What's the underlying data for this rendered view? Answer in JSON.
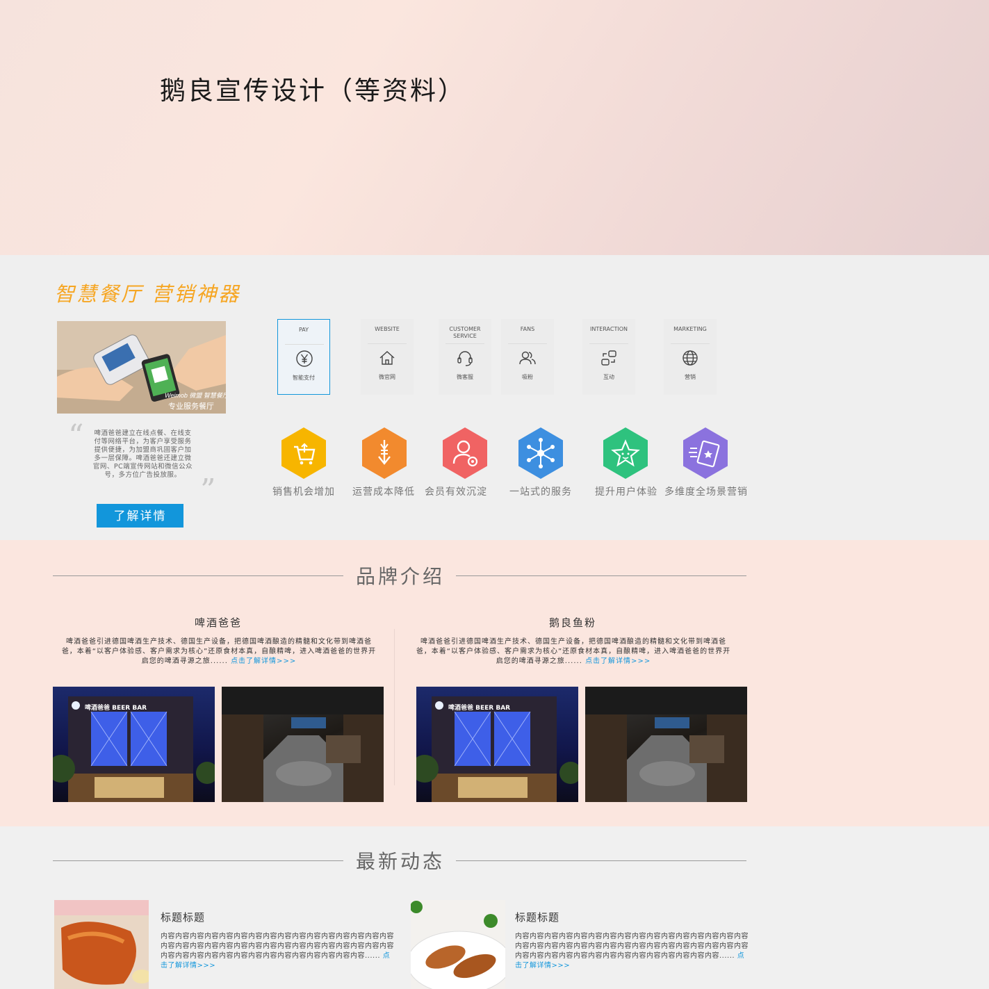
{
  "hero": {
    "title": "鹅良宣传设计（等资料）"
  },
  "smart": {
    "slogan": "智慧餐厅  营销神器",
    "photo_caption_1": "Weimob 微盟 智慧餐厅",
    "photo_caption_2": "专业服务餐厅",
    "intro": "啤酒爸爸建立在线点餐、在线支付等网络平台，为客户享受服务提供便捷，为加盟商巩固客户加多一层保障。啤酒爸爸还建立微官网、PC端宣传网站和微信公众号，多方位广告投放服。",
    "button": "了解详情",
    "services": [
      {
        "en": "PAY",
        "cn": "智能支付",
        "icon": "yuan-icon"
      },
      {
        "en": "WEBSITE",
        "cn": "微官网",
        "icon": "home-icon"
      },
      {
        "en": "CUSTOMER SERVICE",
        "cn": "微客服",
        "icon": "headset-icon"
      },
      {
        "en": "FANS",
        "cn": "吸粉",
        "icon": "users-icon"
      },
      {
        "en": "INTERACTION",
        "cn": "互动",
        "icon": "interaction-icon"
      },
      {
        "en": "MARKETING",
        "cn": "营销",
        "icon": "globe-icon"
      }
    ],
    "features": [
      {
        "label": "销售机会增加",
        "color": "#f7b500",
        "icon": "cart-icon"
      },
      {
        "label": "运营成本降低",
        "color": "#f28a2e",
        "icon": "cost-down-icon"
      },
      {
        "label": "会员有效沉淀",
        "color": "#f06363",
        "icon": "member-icon"
      },
      {
        "label": "一站式的服务",
        "color": "#3d8fe0",
        "icon": "network-icon"
      },
      {
        "label": "提升用户体验",
        "color": "#2ec27e",
        "icon": "star-face-icon"
      },
      {
        "label": "多维度全场景营销",
        "color": "#8b72de",
        "icon": "ticket-icon"
      }
    ]
  },
  "brand": {
    "title": "品牌介绍",
    "items": [
      {
        "name": "啤酒爸爸",
        "desc": "啤酒爸爸引进德国啤酒生产技术、德国生产设备，把德国啤酒酿造的精髓和文化带到啤酒爸爸，本着“以客户体验感、客户需求为核心”还原食材本真，自酿精啤，进入啤酒爸爸的世界开启您的啤酒寻源之旅......",
        "link": "点击了解详情>>>"
      },
      {
        "name": "鹅良鱼粉",
        "desc": "啤酒爸爸引进德国啤酒生产技术、德国生产设备，把德国啤酒酿造的精髓和文化带到啤酒爸爸，本着“以客户体验感、客户需求为核心”还原食材本真，自酿精啤，进入啤酒爸爸的世界开启您的啤酒寻源之旅......",
        "link": "点击了解详情>>>"
      }
    ],
    "sign_text": "啤酒爸爸 BEER BAR"
  },
  "news": {
    "title": "最新动态",
    "items": [
      {
        "title": "标题标题",
        "body": "内容内容内容内容内容内容内容内容内容内容内容内容内容内容内容内容内容内容内容内容内容内容内容内容内容内容内容内容内容内容内容内容内容内容内容内容内容内容内容内容内容内容内容内容内容内容......",
        "link": "点击了解详情>>>"
      },
      {
        "title": "标题标题",
        "body": "内容内容内容内容内容内容内容内容内容内容内容内容内容内容内容内容内容内容内容内容内容内容内容内容内容内容内容内容内容内容内容内容内容内容内容内容内容内容内容内容内容内容内容内容内容内容......",
        "link": "点击了解详情>>>"
      }
    ]
  }
}
